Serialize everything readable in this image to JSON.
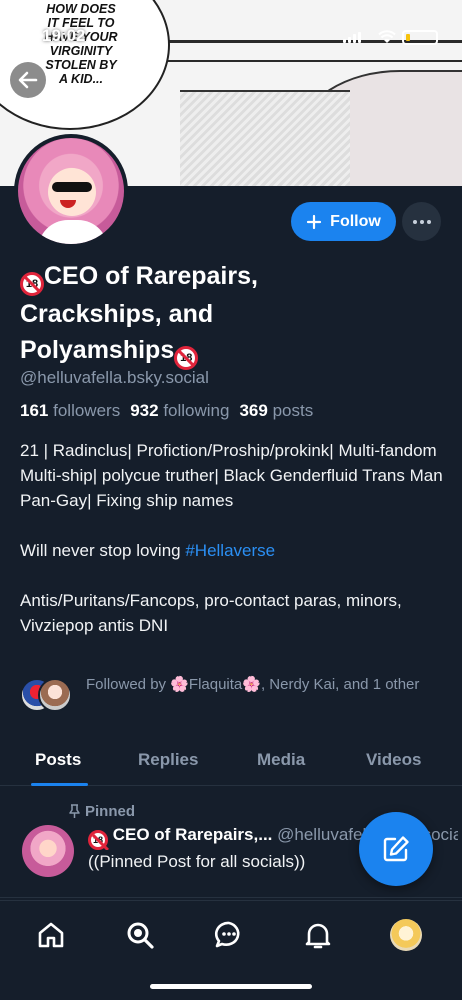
{
  "status_bar": {
    "time": "19:02"
  },
  "banner": {
    "speech_bubble": "HOW DOES\nIT FEEL TO\nHAVE YOUR\nVIRGINITY\nSTOLEN BY\nA KID..."
  },
  "profile": {
    "display_name": "CEO of Rarepairs, Crackships, and Polyamships",
    "handle": "@helluvafella.bsky.social",
    "follow_label": "Follow",
    "stats": {
      "followers_count": "161",
      "followers_label": "followers",
      "following_count": "932",
      "following_label": "following",
      "posts_count": "369",
      "posts_label": "posts"
    },
    "bio": {
      "line1": "21 | Radinclus| Profiction/Proship/prokink| Multi-fandom Multi-ship| polycue truther| Black Genderfluid Trans Man Pan-Gay| Fixing ship names",
      "line2_prefix": "Will never stop loving ",
      "line2_tag": "#Hellaverse",
      "line3": "Antis/Puritans/Fancops, pro-contact paras, minors, Vivziepop antis DNI"
    },
    "followed_by": {
      "prefix": "Followed by ",
      "name1": "Flaquita",
      "middle": ", Nerdy Kai, and 1 other"
    },
    "badge_text": "18"
  },
  "tabs": [
    "Posts",
    "Replies",
    "Media",
    "Videos"
  ],
  "pinned_post": {
    "pinned_label": "Pinned",
    "author_name": "CEO of Rarepairs,...",
    "author_handle": "@helluvafella.bsky.social",
    "text": "((Pinned Post for all socials))"
  },
  "colors": {
    "accent": "#1b83ef",
    "background": "#151e2b",
    "muted": "#8a98ab"
  }
}
